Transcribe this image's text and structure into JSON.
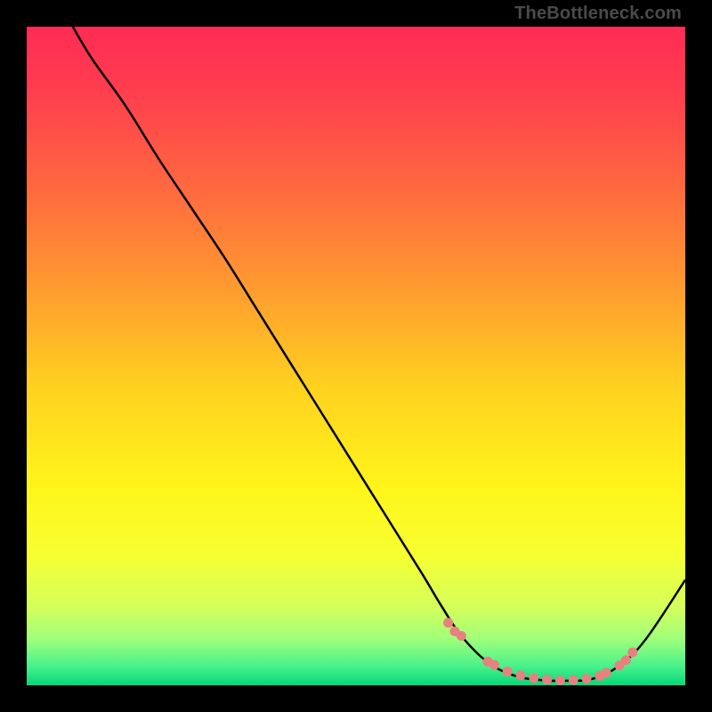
{
  "attribution": "TheBottleneck.com",
  "chart_data": {
    "type": "line",
    "title": "",
    "xlabel": "",
    "ylabel": "",
    "xlim": [
      0,
      100
    ],
    "ylim": [
      0,
      100
    ],
    "background_gradient": {
      "stops": [
        {
          "pos": 0.0,
          "color": "#ff2b54"
        },
        {
          "pos": 0.1,
          "color": "#ff3e4e"
        },
        {
          "pos": 0.25,
          "color": "#ff6a3f"
        },
        {
          "pos": 0.4,
          "color": "#ff9c2f"
        },
        {
          "pos": 0.55,
          "color": "#ffd21f"
        },
        {
          "pos": 0.7,
          "color": "#fff51a"
        },
        {
          "pos": 0.8,
          "color": "#f7ff30"
        },
        {
          "pos": 0.88,
          "color": "#d5ff5a"
        },
        {
          "pos": 0.93,
          "color": "#9fff7a"
        },
        {
          "pos": 0.97,
          "color": "#4bf28a"
        },
        {
          "pos": 1.0,
          "color": "#05d77a"
        }
      ]
    },
    "series": [
      {
        "name": "bottleneck-curve",
        "color": "#000000",
        "x": [
          7,
          10,
          15,
          20,
          25,
          30,
          35,
          40,
          45,
          50,
          55,
          60,
          63,
          66,
          70,
          74,
          78,
          82,
          86,
          90,
          94,
          100
        ],
        "y": [
          100,
          95,
          88,
          80,
          72.5,
          65,
          57,
          49,
          41,
          33,
          25,
          17,
          12,
          7.5,
          3.5,
          1.5,
          0.8,
          0.7,
          1.0,
          3.0,
          7.0,
          16.0
        ]
      }
    ],
    "markers": {
      "name": "highlight-range",
      "color": "#e98080",
      "points": [
        {
          "x": 64,
          "y": 9.5
        },
        {
          "x": 65,
          "y": 8.2
        },
        {
          "x": 66,
          "y": 7.5
        },
        {
          "x": 70,
          "y": 3.6
        },
        {
          "x": 71,
          "y": 3.1
        },
        {
          "x": 73,
          "y": 2.1
        },
        {
          "x": 75,
          "y": 1.5
        },
        {
          "x": 77,
          "y": 1.1
        },
        {
          "x": 79,
          "y": 0.85
        },
        {
          "x": 81,
          "y": 0.75
        },
        {
          "x": 83,
          "y": 0.8
        },
        {
          "x": 85,
          "y": 1.0
        },
        {
          "x": 87,
          "y": 1.4
        },
        {
          "x": 88,
          "y": 1.9
        },
        {
          "x": 90,
          "y": 3.0
        },
        {
          "x": 91,
          "y": 3.8
        },
        {
          "x": 92,
          "y": 5.0
        }
      ]
    }
  }
}
